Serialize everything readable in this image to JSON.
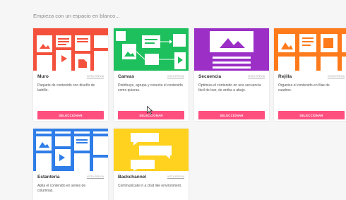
{
  "heading": "Empieza con un espacio en blanco...",
  "cards": [
    {
      "title": "Muro",
      "preview": "VISTA PREVIA",
      "description": "Paquete de contenido con diseño de ladrillo.",
      "button": "SELECCIONAR",
      "color": "#f4513c"
    },
    {
      "title": "Canvas",
      "preview": "VISTA PREVIA",
      "description": "Distribuye, agrupa y conecta el contenido como quieras.",
      "button": "SELECCIONAR",
      "color": "#1ec05e"
    },
    {
      "title": "Secuencia",
      "preview": "VISTA PREVIA",
      "description": "Optimiza el contenido en una secuencia fácil de leer, de arriba a abajo.",
      "button": "SELECCIONAR",
      "color": "#9b2fc6"
    },
    {
      "title": "Rejilla",
      "preview": "VISTA PREVIA",
      "description": "Organiza el contenido en filas de cuadros.",
      "button": "SELECCIONAR",
      "color": "#ff7a1a"
    },
    {
      "title": "Estantería",
      "preview": "VISTA PREVIA",
      "description": "Apila el contenido en series de columnas.",
      "button": "SELECCIONAR",
      "color": "#2f7de8"
    },
    {
      "title": "Backchannel",
      "preview": "VISTA PREVIA",
      "description": "Communicate in a chat like environment.",
      "button": "SELECCIONAR",
      "color": "#ffd21f"
    }
  ],
  "accent_color": "#ff4f7f"
}
